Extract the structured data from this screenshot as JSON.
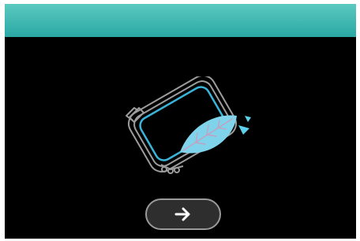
{
  "colors": {
    "header_top": "#5bc9c0",
    "header_bottom": "#2aa8a4",
    "screen_background": "#000000",
    "hoop_outline": "#9c9c9c",
    "hoop_inner_outline": "#3ab3d8",
    "leaf_fill": "#7fd3ea",
    "leaf_vein": "#c59fc0",
    "accent_triangles": "#5fd0ea",
    "button_background": "#2e2e2e",
    "button_border": "#9a9a9a",
    "arrow": "#ffffff"
  },
  "illustration": {
    "icon": "embroidery-hoop-with-leaf-icon"
  },
  "next_button": {
    "icon": "arrow-right-icon"
  }
}
